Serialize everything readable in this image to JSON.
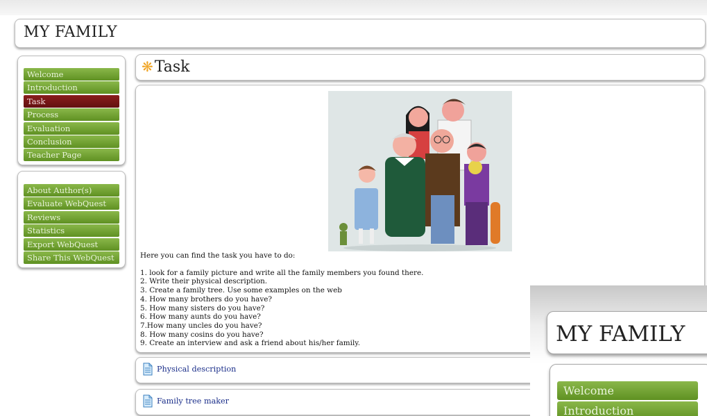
{
  "site": {
    "title": "MY FAMILY"
  },
  "nav_main": [
    {
      "label": "Welcome",
      "active": false
    },
    {
      "label": "Introduction",
      "active": false
    },
    {
      "label": "Task",
      "active": true
    },
    {
      "label": "Process",
      "active": false
    },
    {
      "label": "Evaluation",
      "active": false
    },
    {
      "label": "Conclusion",
      "active": false
    },
    {
      "label": "Teacher Page",
      "active": false
    }
  ],
  "nav_secondary": [
    {
      "label": "About Author(s)"
    },
    {
      "label": "Evaluate WebQuest"
    },
    {
      "label": "Reviews"
    },
    {
      "label": "Statistics"
    },
    {
      "label": "Export WebQuest"
    },
    {
      "label": "Share This WebQuest"
    }
  ],
  "page": {
    "title": "Task",
    "title_icon": "star-icon",
    "intro": "Here you can find the task you have to do:",
    "tasks": [
      "1. look for a family picture and write all the family members you found there.",
      "2. Write their physical description.",
      "3. Create a family tree. Use some examples on the web",
      "4. How many brothers do you have?",
      "5.  How many sisters do you have?",
      "6. How many aunts do you have?",
      "7.How many uncles do you have?",
      "8. How many cosins do you have?",
      "9. Create an interview and ask a friend about his/her family."
    ]
  },
  "resources": [
    {
      "label": "Physical description",
      "icon": "document-icon"
    },
    {
      "label": "Family tree maker",
      "icon": "document-icon"
    }
  ],
  "zoom": {
    "title": "MY FAMILY",
    "items": [
      "Welcome",
      "Introduction"
    ]
  },
  "colors": {
    "nav_green": "#6e9f30",
    "nav_active": "#7a1616",
    "link": "#1b2f8a",
    "star": "#f0a526"
  }
}
